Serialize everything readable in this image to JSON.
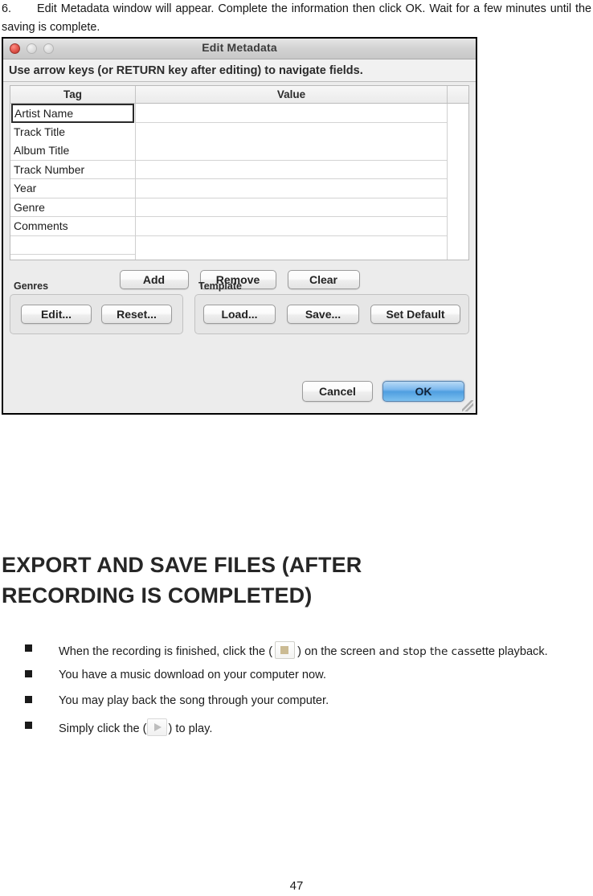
{
  "step": {
    "number": "6.",
    "text": "Edit Metadata window will appear. Complete the information then click OK. Wait for a few minutes until the saving is complete."
  },
  "dialog": {
    "title": "Edit Metadata",
    "traffic_lights": [
      "close-red",
      "minimize-gray",
      "zoom-gray"
    ],
    "hint": "Use arrow keys (or RETURN key after editing) to navigate fields.",
    "table": {
      "columns": [
        "Tag",
        "Value"
      ],
      "rows": [
        {
          "tag": "Artist Name",
          "value": "",
          "selected": true
        },
        {
          "tag": "Track Title",
          "value": "",
          "selected": false
        },
        {
          "tag": "Album Title",
          "value": "",
          "selected": false
        },
        {
          "tag": "Track Number",
          "value": "",
          "selected": false
        },
        {
          "tag": "Year",
          "value": "",
          "selected": false
        },
        {
          "tag": "Genre",
          "value": "",
          "selected": false
        },
        {
          "tag": "Comments",
          "value": "",
          "selected": false
        },
        {
          "tag": "",
          "value": "",
          "selected": false
        }
      ]
    },
    "actions": {
      "add": "Add",
      "remove": "Remove",
      "clear": "Clear"
    },
    "genres_group": {
      "label": "Genres",
      "edit": "Edit...",
      "reset": "Reset..."
    },
    "template_group": {
      "label": "Template",
      "load": "Load...",
      "save": "Save...",
      "set_default": "Set Default"
    },
    "footer": {
      "cancel": "Cancel",
      "ok": "OK",
      "ok_accent": "#4f9ee0"
    }
  },
  "heading": "EXPORT AND SAVE FILES (AFTER RECORDING IS COMPLETED)",
  "bullets": [
    {
      "pre": "When the recording is finished, click the (",
      "icon": "stop-button-icon",
      "mid": ") on the screen ",
      "bold": "and stop the cass",
      "post": "ette playback."
    },
    {
      "pre": "You have a music download on your computer now.",
      "icon": "",
      "mid": "",
      "bold": "",
      "post": ""
    },
    {
      "pre": "You may play back the song through your computer.",
      "icon": "",
      "mid": "",
      "bold": "",
      "post": ""
    },
    {
      "pre": "Simply click the (",
      "icon": "play-button-icon",
      "mid": ") to play.",
      "bold": "",
      "post": ""
    }
  ],
  "page_number": "47"
}
